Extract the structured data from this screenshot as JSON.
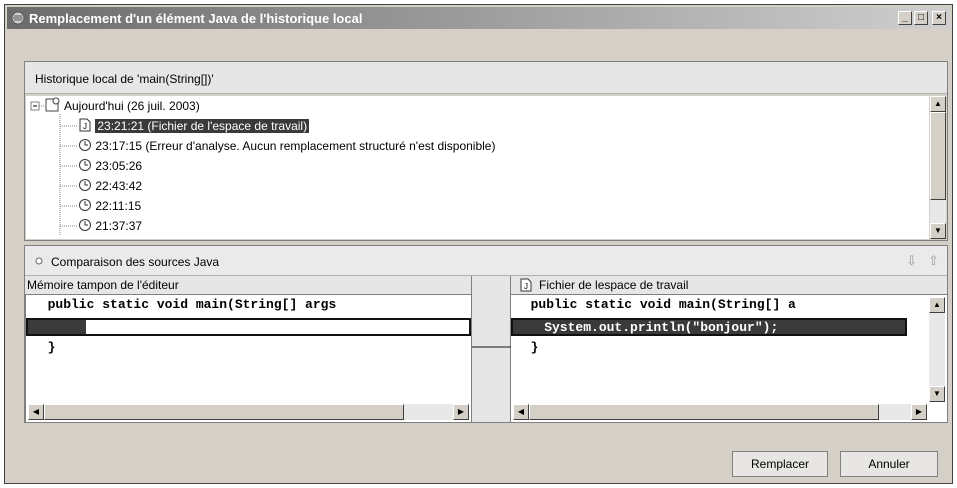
{
  "window": {
    "title": "Remplacement d'un élément Java de l'historique local"
  },
  "history": {
    "header": "Historique local de 'main(String[])'",
    "root_label": "Aujourd'hui (26 juil. 2003)",
    "items": [
      {
        "label": "23:21:21 (Fichier de l'espace de travail)",
        "icon": "java-file-icon",
        "selected": true
      },
      {
        "label": "23:17:15 (Erreur d'analyse. Aucun remplacement structuré n'est disponible)",
        "icon": "clock-icon"
      },
      {
        "label": "23:05:26",
        "icon": "clock-icon"
      },
      {
        "label": "22:43:42",
        "icon": "clock-icon"
      },
      {
        "label": "22:11:15",
        "icon": "clock-icon"
      },
      {
        "label": "21:37:37",
        "icon": "clock-icon"
      }
    ]
  },
  "compare": {
    "title": "Comparaison des sources Java",
    "left_header": "Mémoire tampon de l'éditeur",
    "right_header": "Fichier de lespace de travail",
    "left_lines": [
      "  public static void main(String[] args",
      "",
      "  }"
    ],
    "right_lines": [
      "  public static void main(String[] a",
      "    System.out.println(\"bonjour\");",
      "  }"
    ]
  },
  "buttons": {
    "replace": "Remplacer",
    "cancel": "Annuler"
  },
  "colors": {
    "selection": "#3a3a3a",
    "dialog_bg": "#d4d0c8"
  }
}
